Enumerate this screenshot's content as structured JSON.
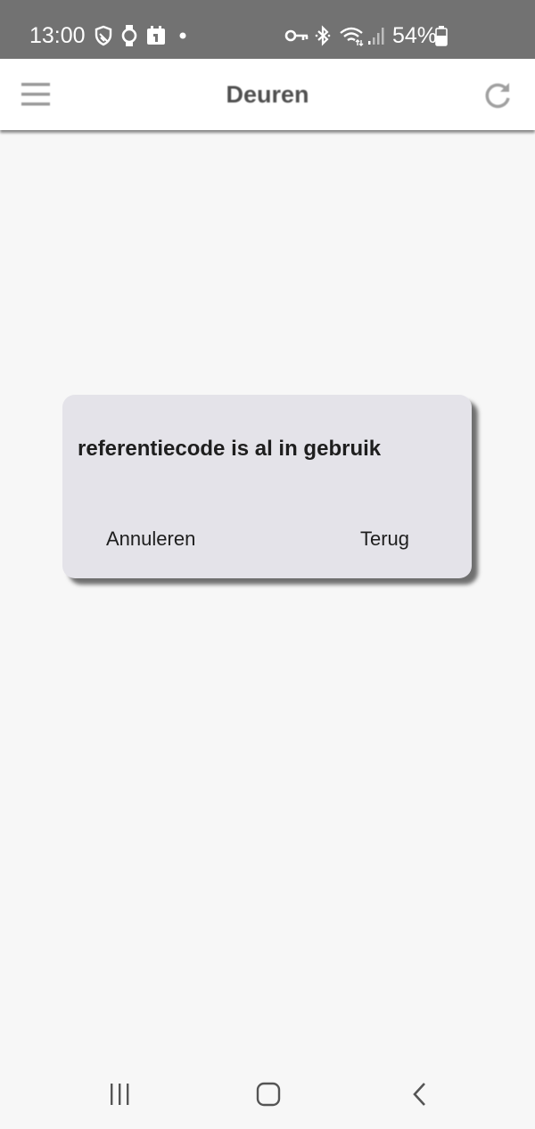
{
  "status_bar": {
    "time": "13:00",
    "battery_percent": "54%",
    "icons": [
      "shield-icon",
      "watch-icon",
      "calendar-icon",
      "notification-dot-icon",
      "vpn-key-icon",
      "bluetooth-icon",
      "wifi-icon",
      "signal-icon",
      "battery-icon"
    ]
  },
  "app_bar": {
    "title": "Deuren",
    "left_icon": "menu-icon",
    "right_icon": "refresh-icon"
  },
  "dialog": {
    "message": "referentiecode is al in gebruik",
    "cancel_label": "Annuleren",
    "back_label": "Terug"
  },
  "nav_bar": {
    "icons": [
      "recent-apps-icon",
      "home-icon",
      "back-icon"
    ]
  },
  "colors": {
    "status_bar_bg": "#727272",
    "app_bar_bg": "#ffffff",
    "page_bg": "#f7f7f7",
    "dialog_bg": "#e4e3e9",
    "title_text": "#505050",
    "dialog_text": "#1e1e1e"
  }
}
